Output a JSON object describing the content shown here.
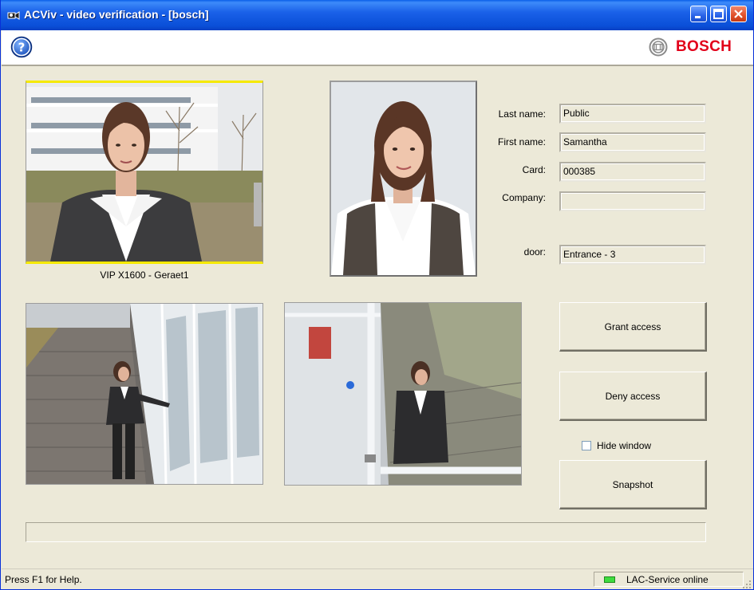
{
  "window": {
    "title": "ACViv - video verification - [bosch]"
  },
  "toolbar": {
    "help_icon": "help-question-icon",
    "brand": "BOSCH",
    "brand_color": "#e2001a"
  },
  "cameras": {
    "main_caption": "VIP X1600 - Geraet1"
  },
  "person": {
    "labels": {
      "last_name": "Last name:",
      "first_name": "First name:",
      "card": "Card:",
      "company": "Company:",
      "door": "door:"
    },
    "values": {
      "last_name": "Public",
      "first_name": "Samantha",
      "card": "000385",
      "company": "",
      "door": "Entrance - 3"
    }
  },
  "actions": {
    "grant": "Grant access",
    "deny": "Deny access",
    "hide_window": "Hide window",
    "snapshot": "Snapshot"
  },
  "progress": {
    "value": 0
  },
  "status": {
    "help_text": "Press F1 for Help.",
    "service_text": "LAC-Service online",
    "service_color": "#3fdc3f"
  }
}
